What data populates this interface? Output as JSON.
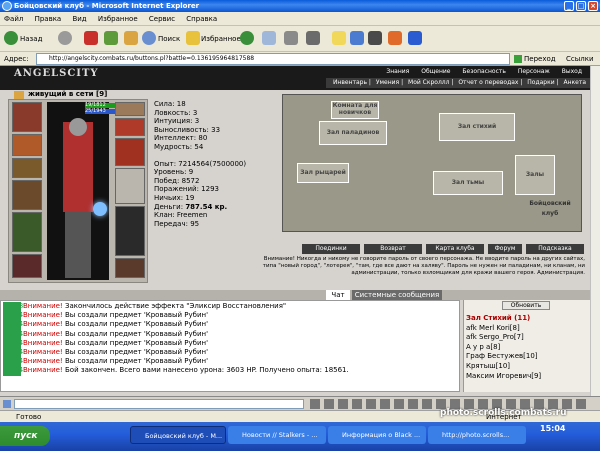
{
  "window": {
    "title": "Бойцовский клуб - Microsoft Internet Explorer"
  },
  "menu": [
    "Файл",
    "Правка",
    "Вид",
    "Избранное",
    "Сервис",
    "Справка"
  ],
  "toolbar": {
    "back": "Назад",
    "search": "Поиск",
    "favorites": "Избранное"
  },
  "address": {
    "label": "Адрес:",
    "url": "http://angelscity.combats.ru/buttons.pl?battle=0.136195964817588",
    "go": "Переход",
    "links": "Ссылки"
  },
  "site": {
    "logo": "ANGELSCITY",
    "nav_top": [
      "Знания",
      "Общение",
      "Безопасность",
      "Персонаж",
      "Выход"
    ],
    "nav_sub": [
      "Инвентарь",
      "Умения",
      "Мой Скроллл",
      "Отчет о переводах",
      "Подарки",
      "Анкета"
    ]
  },
  "character": {
    "name": "живущий в сети [9]",
    "hp": "19/1812",
    "mp": "25/1943",
    "stats": [
      {
        "label": "Сила:",
        "value": "18"
      },
      {
        "label": "Ловкость:",
        "value": "3"
      },
      {
        "label": "Интуиция:",
        "value": "3"
      },
      {
        "label": "Выносливость:",
        "value": "33"
      },
      {
        "label": "Интеллект:",
        "value": "80"
      },
      {
        "label": "Мудрость:",
        "value": "54"
      }
    ],
    "info": [
      {
        "label": "Опыт:",
        "value": "7214564(7500000)"
      },
      {
        "label": "Уровень:",
        "value": "9"
      },
      {
        "label": "Побед:",
        "value": "8572"
      },
      {
        "label": "Поражений:",
        "value": "1293"
      },
      {
        "label": "Ничьих:",
        "value": "19"
      },
      {
        "label": "Деньги:",
        "value": "787.54 кр."
      },
      {
        "label": "Клан:",
        "value": "Freemen"
      },
      {
        "label": "Передач:",
        "value": "95"
      }
    ]
  },
  "map": {
    "buildings": [
      "Комната для новичков",
      "Зал паладинов",
      "Зал стихий",
      "Зал рыцарей",
      "Зал тьмы",
      "Залы",
      "Бойцовский клуб"
    ],
    "buttons": [
      "Поединки",
      "Возврат",
      "Карта клуба",
      "Форум",
      "Подсказка"
    ]
  },
  "warning": "Внимание! Никогда и никому не говорите пароль от своего персонажа. Не вводите пароль на других сайтах, типа \"новый город\", \"лотерея\", \"там, где все дают на халяву\". Пароль не нужен ни паладинам, ни кланам, ни администрации, только взломщикам для кражи вашего героя. Администрация.",
  "chat": {
    "tabs": [
      "Чат",
      "Системные сообщения"
    ],
    "lines": [
      {
        "time": "14:48",
        "prefix": "Внимание!",
        "text": "Закончилось действие эффекта \"Эликсир Восстановления\""
      },
      {
        "time": "15:04",
        "prefix": "Внимание!",
        "text": "Вы создали предмет 'Кровавый Рубин'"
      },
      {
        "time": "15:04",
        "prefix": "Внимание!",
        "text": "Вы создали предмет 'Кровавый Рубин'"
      },
      {
        "time": "15:04",
        "prefix": "Внимание!",
        "text": "Вы создали предмет 'Кровавый Рубин'"
      },
      {
        "time": "15:04",
        "prefix": "Внимание!",
        "text": "Вы создали предмет 'Кровавый Рубин'"
      },
      {
        "time": "15:04",
        "prefix": "Внимание!",
        "text": "Вы создали предмет 'Кровавый Рубин'"
      },
      {
        "time": "15:04",
        "prefix": "Внимание!",
        "text": "Вы создали предмет 'Кровавый Рубин'"
      },
      {
        "time": "15:04",
        "prefix": "Внимание!",
        "text": "Бой закончен. Всего вами нанесено урона: 3603 HP. Получено опыта: 18561."
      }
    ]
  },
  "users": {
    "refresh": "Обновить",
    "room": "Зал Стихий (11)",
    "list": [
      "afk Merl Kori[8]",
      "afk Sergo_Pro[7]",
      "А у р а[8]",
      "Граф Бестужев[10]",
      "Крятыш[10]",
      "Максим Игоревич[9]"
    ]
  },
  "statusbar": {
    "left": "Готово",
    "right": "Интернет",
    "clock": "15:04"
  },
  "taskbar": {
    "start": "пуск",
    "tasks": [
      "Бойцовский клуб - М...",
      "Новости // Stalkers - ...",
      "Информация о Black ...",
      "http://photo.scrolls..."
    ]
  },
  "watermark": "photo.scrolls.combats.ru"
}
